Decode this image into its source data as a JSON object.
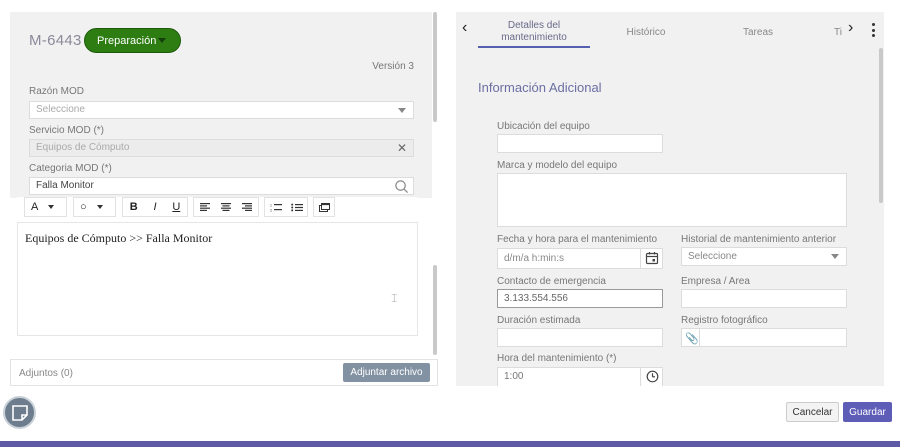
{
  "record": {
    "id": "M-6443",
    "status": "Preparación",
    "version": "Versión 3"
  },
  "form": {
    "razon": {
      "label": "Razón MOD",
      "placeholder": "Seleccione"
    },
    "servicio": {
      "label": "Servicio MOD (*)",
      "value": "Equipos de Cómputo"
    },
    "categoria": {
      "label": "Categoria MOD (*)",
      "value": "Falla Monitor"
    }
  },
  "editor": {
    "font_select": "A",
    "color_select": "○",
    "bold": "B",
    "italic": "I",
    "underline": "U",
    "content": "Equipos de Cómputo >> Falla Monitor"
  },
  "attachments": {
    "label": "Adjuntos (0)",
    "button": "Adjuntar archivo"
  },
  "tabs": [
    {
      "label": "Detalles del mantenimiento",
      "active": true
    },
    {
      "label": "Histórico",
      "active": false
    },
    {
      "label": "Tareas",
      "active": false
    },
    {
      "label": "Ti",
      "active": false
    }
  ],
  "details": {
    "section_title": "Información Adicional",
    "ubicacion": {
      "label": "Ubicación del equipo",
      "value": ""
    },
    "marca": {
      "label": "Marca y modelo del equipo",
      "value": ""
    },
    "fecha": {
      "label": "Fecha y hora para el mantenimiento",
      "placeholder": "d/m/a h:min:s"
    },
    "historial": {
      "label": "Historial de mantenimiento anterior",
      "placeholder": "Seleccione"
    },
    "contacto": {
      "label": "Contacto de emergencia",
      "value": "3.133.554.556"
    },
    "empresa": {
      "label": "Empresa / Area",
      "value": ""
    },
    "duracion": {
      "label": "Duración estimada",
      "value": ""
    },
    "registro": {
      "label": "Registro fotográfico",
      "value": ""
    },
    "hora": {
      "label": "Hora del mantenimiento (*)",
      "value": "1:00"
    }
  },
  "actions": {
    "cancel": "Cancelar",
    "save": "Guardar"
  },
  "colors": {
    "status": "#2e7d12",
    "accent": "#5d5db8",
    "attach_button": "#8292a3",
    "bottom_bar": "#5e5aa6"
  }
}
